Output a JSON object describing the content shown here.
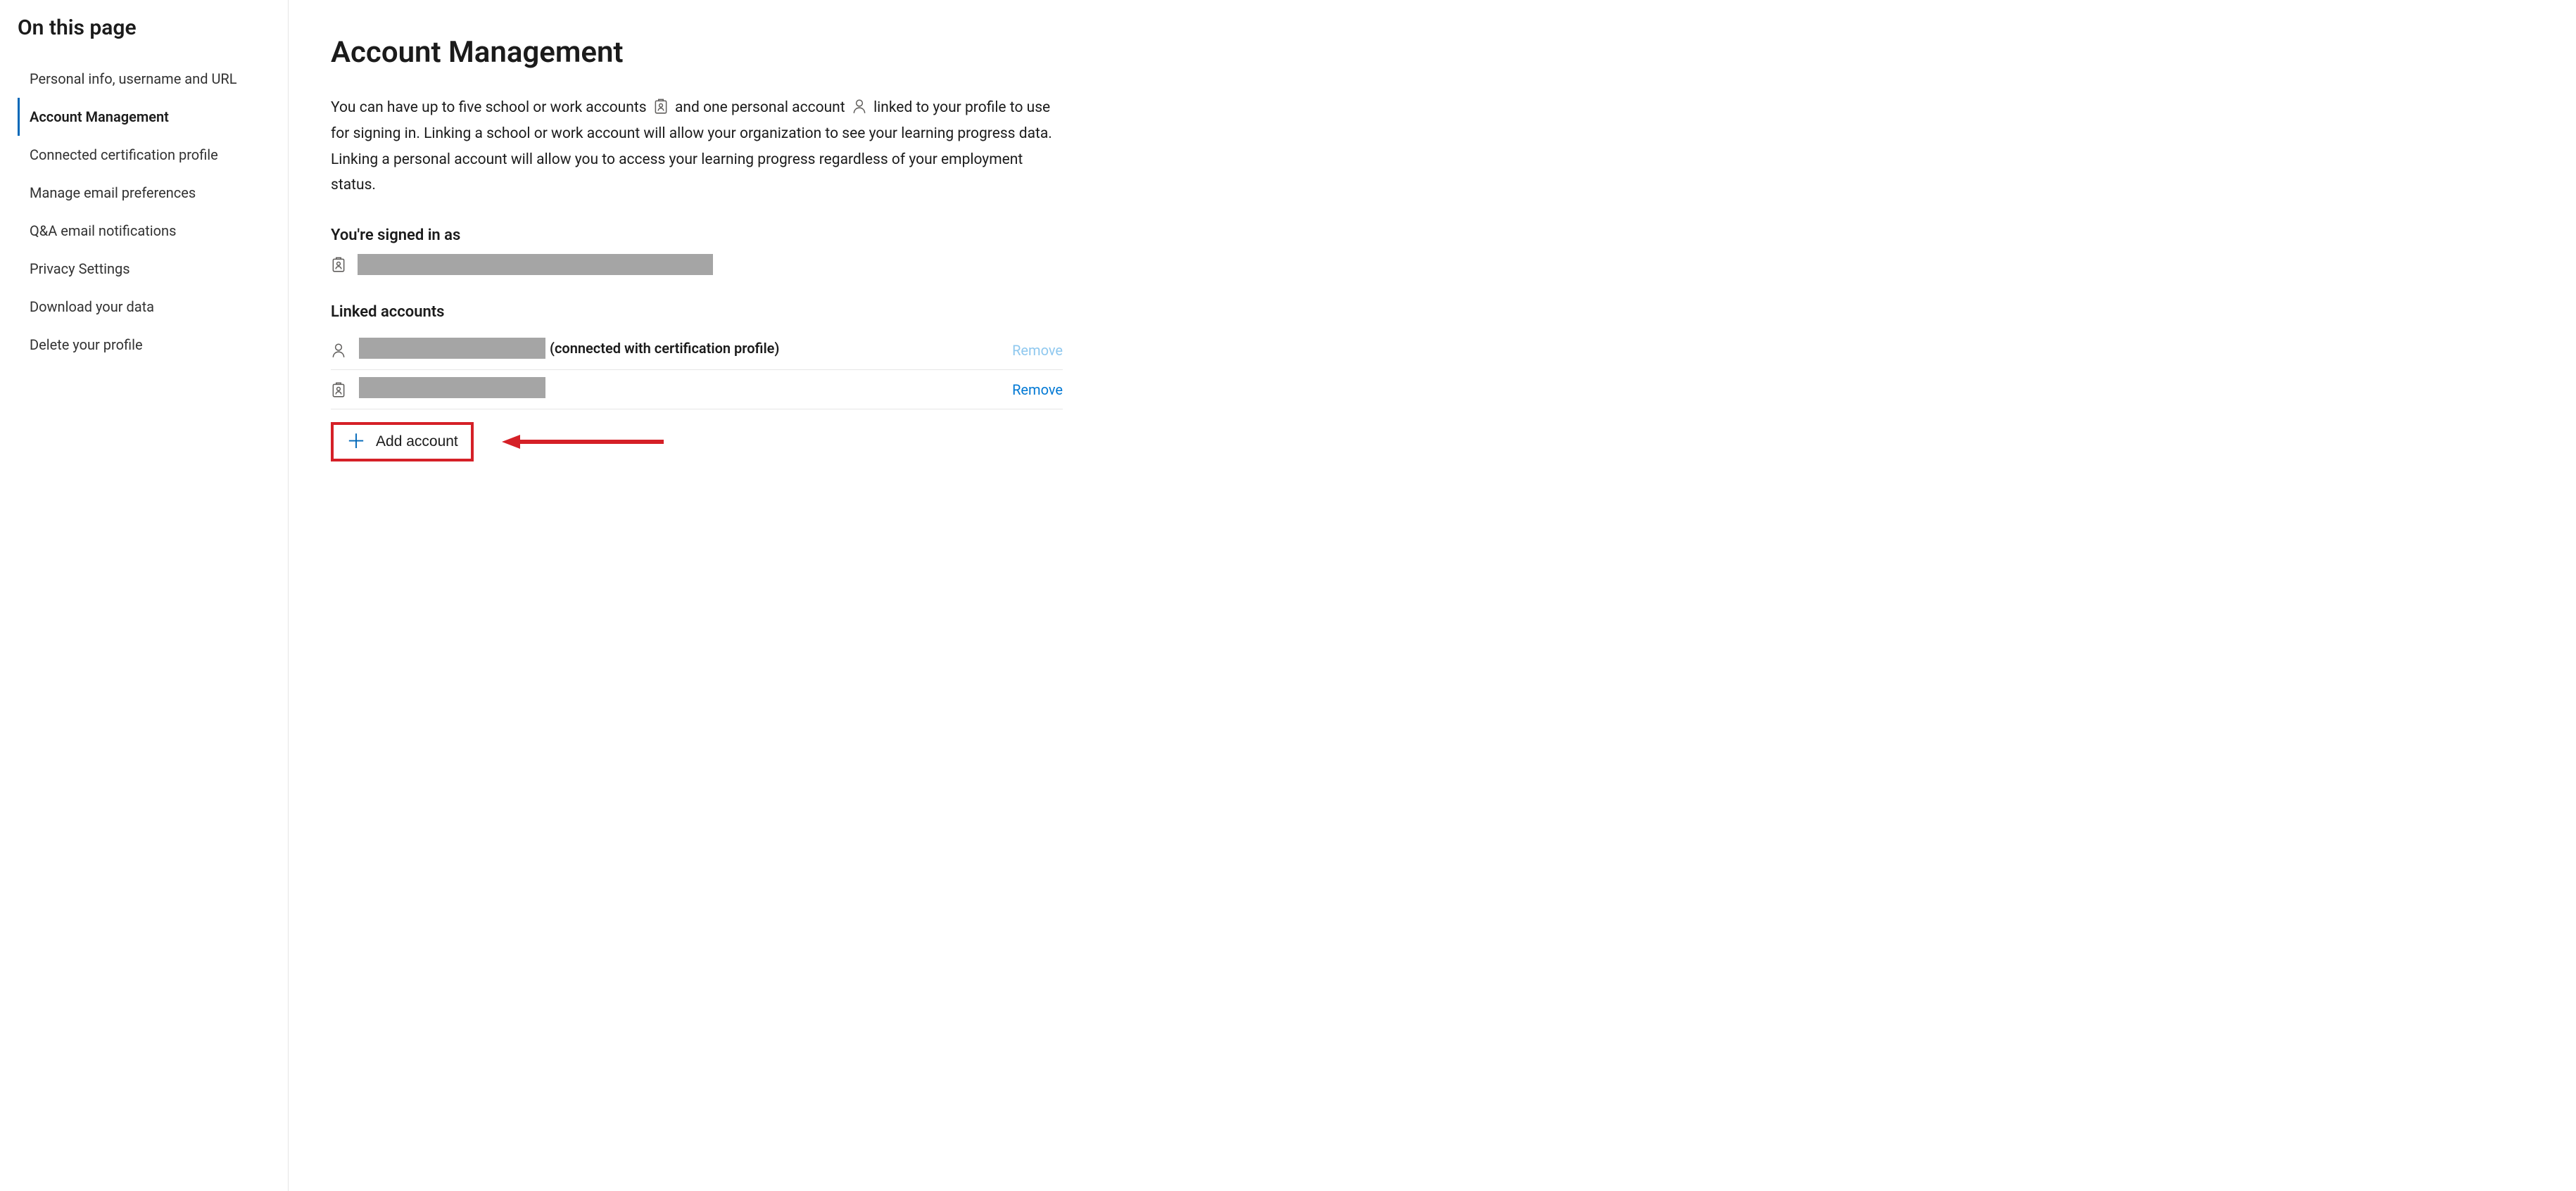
{
  "sidebar": {
    "title": "On this page",
    "items": [
      {
        "label": "Personal info, username and URL",
        "active": false
      },
      {
        "label": "Account Management",
        "active": true
      },
      {
        "label": "Connected certification profile",
        "active": false
      },
      {
        "label": "Manage email preferences",
        "active": false
      },
      {
        "label": "Q&A email notifications",
        "active": false
      },
      {
        "label": "Privacy Settings",
        "active": false
      },
      {
        "label": "Download your data",
        "active": false
      },
      {
        "label": "Delete your profile",
        "active": false
      }
    ]
  },
  "main": {
    "title": "Account Management",
    "intro": {
      "part1": "You can have up to five school or work accounts",
      "part2": "and one personal account",
      "part3": "linked to your profile to use for signing in. Linking a school or work account will allow your organization to see your learning progress data. Linking a personal account will allow you to access your learning progress regardless of your employment status."
    },
    "signedInHeading": "You're signed in as",
    "linkedHeading": "Linked accounts",
    "linked": [
      {
        "note": "(connected with certification profile)",
        "action": "Remove",
        "actionLight": true,
        "iconType": "person"
      },
      {
        "note": "",
        "action": "Remove",
        "actionLight": false,
        "iconType": "badge"
      }
    ],
    "addAccountLabel": "Add account"
  },
  "callout": {
    "arrowColor": "#d52027"
  }
}
